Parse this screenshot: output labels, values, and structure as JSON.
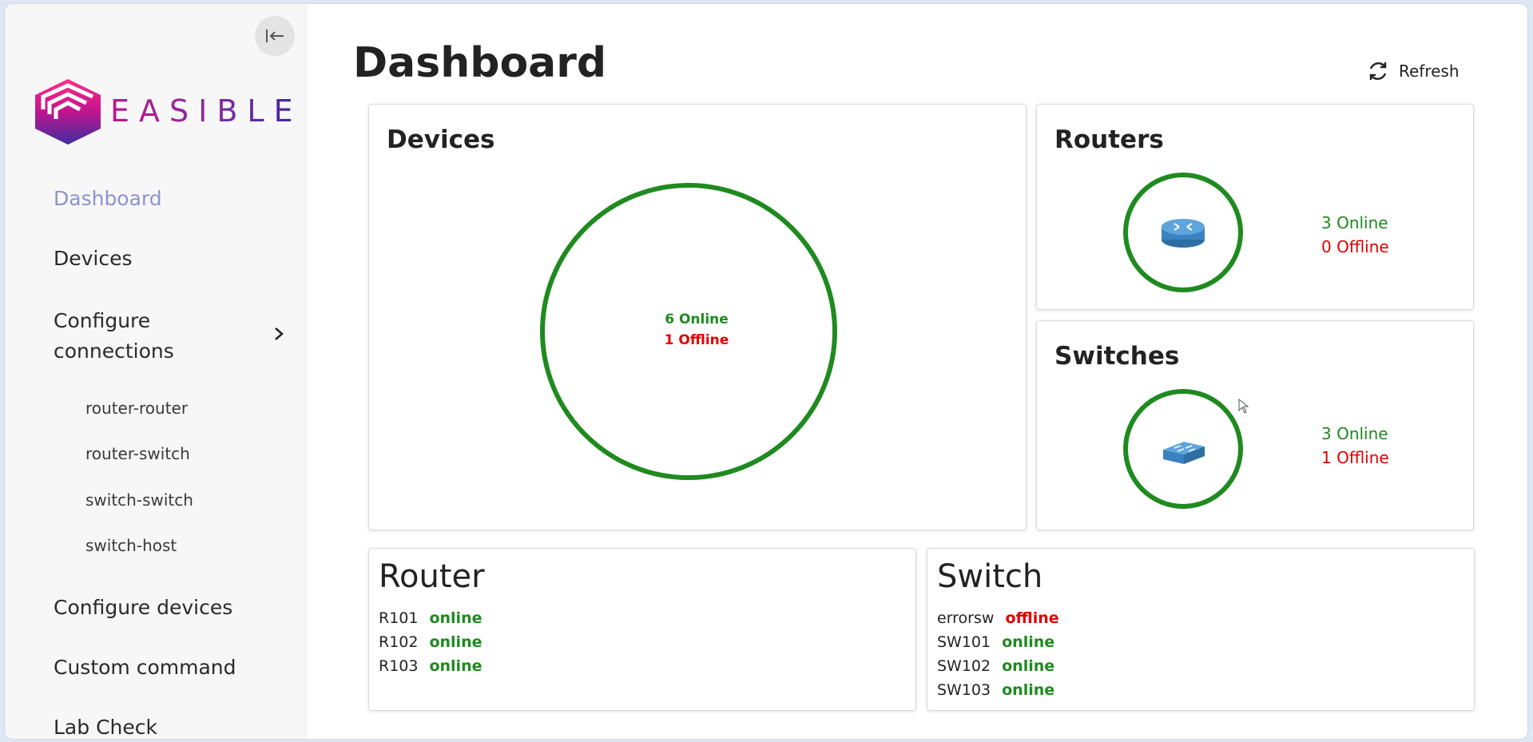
{
  "sidebar": {
    "logo_text": "EASIBLE",
    "items": [
      {
        "label": "Dashboard",
        "active": true
      },
      {
        "label": "Devices"
      },
      {
        "label": "Configure connections",
        "expanded": true,
        "children": [
          "router-router",
          "router-switch",
          "switch-switch",
          "switch-host"
        ]
      },
      {
        "label": "Configure devices"
      },
      {
        "label": "Custom command"
      },
      {
        "label": "Lab Check"
      }
    ]
  },
  "header": {
    "title": "Dashboard",
    "refresh_label": "Refresh"
  },
  "colors": {
    "online": "#1f8a1f",
    "offline": "#e00000",
    "active_nav": "#8e92d2"
  },
  "cards": {
    "devices": {
      "title": "Devices",
      "online": 6,
      "offline": 1,
      "online_text": "6 Online",
      "offline_text": "1 Offline"
    },
    "routers": {
      "title": "Routers",
      "online": 3,
      "offline": 0,
      "online_text": "3 Online",
      "offline_text": "0 Offline",
      "icon": "router-icon"
    },
    "switches": {
      "title": "Switches",
      "online": 3,
      "offline": 1,
      "online_text": "3 Online",
      "offline_text": "1 Offline",
      "icon": "switch-icon"
    }
  },
  "router_list": {
    "title": "Router",
    "rows": [
      {
        "name": "R101",
        "status": "online"
      },
      {
        "name": "R102",
        "status": "online"
      },
      {
        "name": "R103",
        "status": "online"
      }
    ]
  },
  "switch_list": {
    "title": "Switch",
    "rows": [
      {
        "name": "errorsw",
        "status": "offline"
      },
      {
        "name": "SW101",
        "status": "online"
      },
      {
        "name": "SW102",
        "status": "online"
      },
      {
        "name": "SW103",
        "status": "online"
      }
    ]
  }
}
